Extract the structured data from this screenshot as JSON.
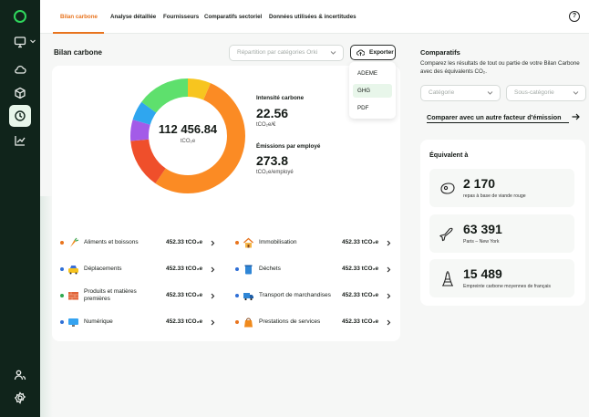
{
  "colors": {
    "accent_orange": "#e8741e",
    "sidebar_bg": "#10241b",
    "logo_green": "#2fd65c",
    "selected_green_bg": "#e8f6ea"
  },
  "sidebar": {
    "icons": [
      "logo-ring",
      "monitor-icon",
      "cloud-icon",
      "box-icon",
      "history-icon",
      "chart-icon",
      "users-icon",
      "settings-icon"
    ]
  },
  "tabs": [
    {
      "label": "Bilan carbone",
      "active": true
    },
    {
      "label": "Analyse détaillée"
    },
    {
      "label": "Fournisseurs"
    },
    {
      "label": "Comparatifs sectoriel"
    },
    {
      "label": "Données utilisées & incertitudes"
    }
  ],
  "help_label": "?",
  "bilan": {
    "title": "Bilan carbone",
    "repartition_placeholder": "Répartition par catégories Orki",
    "export_label": "Exporter",
    "export_options": [
      "ADEME",
      "GHG",
      "PDF"
    ],
    "export_selected": "GHG"
  },
  "donut": {
    "total": "112 456.84",
    "unit": "tCO₂e",
    "segments": [
      {
        "color": "#f7c51f",
        "share": 0.065
      },
      {
        "color": "#fb8b24",
        "share": 0.53
      },
      {
        "color": "#ef4f2b",
        "share": 0.14
      },
      {
        "color": "#a35be8",
        "share": 0.06
      },
      {
        "color": "#2fa6ef",
        "share": 0.055
      },
      {
        "color": "#5ee06d",
        "share": 0.15
      }
    ]
  },
  "kpis": {
    "intensity_label": "Intensité carbone",
    "intensity_value": "22.56",
    "intensity_unit": "tCO₂e/€",
    "employee_label": "Émissions par employé",
    "employee_value": "273.8",
    "employee_unit": "tCO₂e/employé"
  },
  "categories": [
    {
      "label": "Aliments et boissons",
      "value": "452.33 tCO₂e",
      "dot": "#e8741e",
      "icon": "carrot-icon"
    },
    {
      "label": "Immobilisation",
      "value": "452.33 tCO₂e",
      "dot": "#e8741e",
      "icon": "house-icon"
    },
    {
      "label": "Déplacements",
      "value": "452.33 tCO₂e",
      "dot": "#2f6fd6",
      "icon": "taxi-icon"
    },
    {
      "label": "Déchets",
      "value": "452.33 tCO₂e",
      "dot": "#2f6fd6",
      "icon": "trash-icon"
    },
    {
      "label": "Produits et matières premières",
      "value": "452.33 tCO₂e",
      "dot": "#2fa84f",
      "icon": "bricks-icon"
    },
    {
      "label": "Transport de marchandises",
      "value": "452.33 tCO₂e",
      "dot": "#2f6fd6",
      "icon": "truck-icon"
    },
    {
      "label": "Numérique",
      "value": "452.33 tCO₂e",
      "dot": "#2f6fd6",
      "icon": "monitor-icon"
    },
    {
      "label": "Prestations de services",
      "value": "452.33 tCO₂e",
      "dot": "#e8741e",
      "icon": "bag-icon"
    }
  ],
  "comparatifs": {
    "title": "Comparatifs",
    "description": "Comparez les résultats de tout ou partie de votre Bilan Carbone avec des équivalents CO₂.",
    "category_placeholder": "Catégorie",
    "subcategory_placeholder": "Sous-catégorie",
    "compare_link": "Comparer avec un autre facteur d'émission"
  },
  "equivalents": {
    "title": "Équivalent à",
    "items": [
      {
        "value": "2 170",
        "label": "repas à base de viande rouge",
        "icon": "steak-icon"
      },
      {
        "value": "63 391",
        "label": "Paris – New York",
        "icon": "plane-icon"
      },
      {
        "value": "15 489",
        "label": "Empreinte carbone moyennes de français",
        "icon": "eiffel-tower-icon"
      }
    ]
  }
}
